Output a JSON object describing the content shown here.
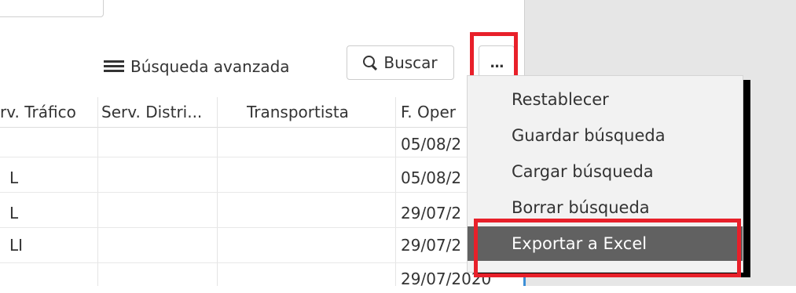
{
  "toolbar": {
    "advanced_search_label": "Búsqueda avanzada",
    "advanced_search_icon": "list-icon",
    "search_label": "Buscar",
    "search_icon": "search-icon",
    "more_label": "..."
  },
  "table": {
    "columns": [
      "rv. Tráfico",
      "Serv. Distri...",
      "Transportista",
      "F. Oper"
    ],
    "rows": [
      {
        "serv_trafico": "",
        "serv_distri": "",
        "transportista": "",
        "f_oper": "05/08/2"
      },
      {
        "serv_trafico": "L",
        "serv_distri": "",
        "transportista": "",
        "f_oper": "05/08/2"
      },
      {
        "serv_trafico": "L",
        "serv_distri": "",
        "transportista": "",
        "f_oper": "29/07/2"
      },
      {
        "serv_trafico": "LI",
        "serv_distri": "",
        "transportista": "",
        "f_oper": "29/07/2"
      },
      {
        "serv_trafico": "",
        "serv_distri": "",
        "transportista": "",
        "f_oper": "29/07/2020"
      }
    ]
  },
  "menu": {
    "items": [
      {
        "label": "Restablecer",
        "active": false
      },
      {
        "label": "Guardar búsqueda",
        "active": false
      },
      {
        "label": "Cargar búsqueda",
        "active": false
      },
      {
        "label": "Borrar búsqueda",
        "active": false
      },
      {
        "label": "Exportar a Excel",
        "active": true
      }
    ]
  },
  "colors": {
    "highlight": "#e8202a",
    "menu_active_bg": "#616161",
    "menu_bg": "#f2f2f2",
    "right_pane_bg": "#e6e6e6"
  }
}
